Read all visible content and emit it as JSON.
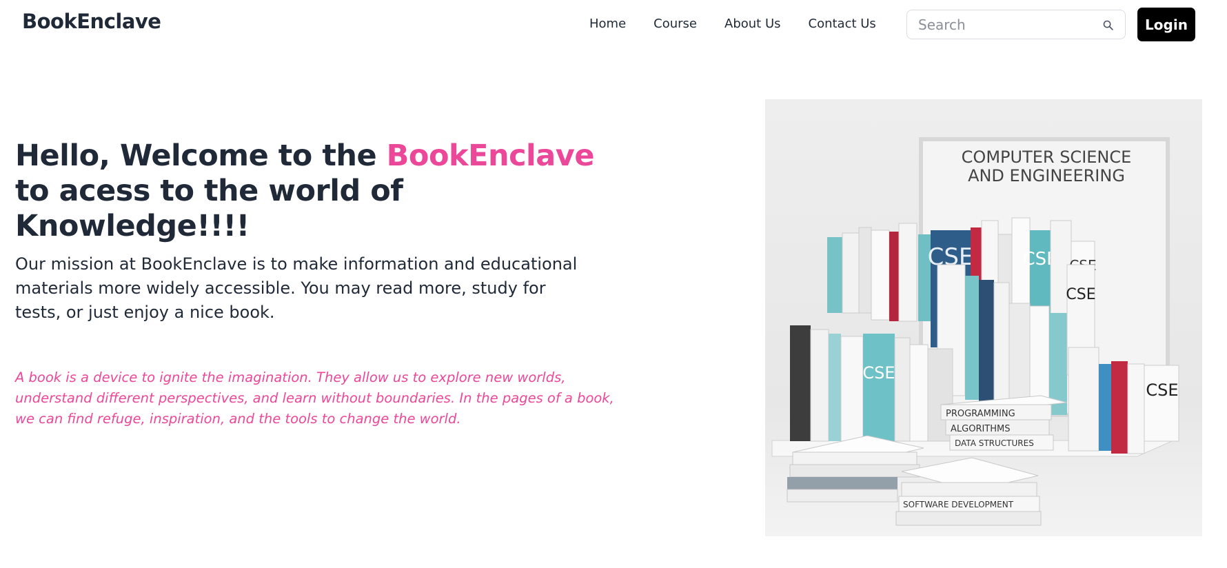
{
  "nav": {
    "brand": "BookEnclave",
    "links": [
      "Home",
      "Course",
      "About Us",
      "Contact Us"
    ],
    "search_placeholder": "Search",
    "login_label": "Login"
  },
  "hero": {
    "title_part1": "Hello, Welcome to the ",
    "title_highlight": "BookEnclave",
    "title_part2": " to acess to the world of Knowledge!!!!",
    "mission": "Our mission at BookEnclave is to make information and educational materials more widely accessible. You may read more, study for tests, or just enjoy a nice book.",
    "quote": "A book is a device to ignite the imagination. They allow us to explore new worlds, understand different perspectives, and learn without boundaries. In the pages of a book, we can find refuge, inspiration, and the tools to change the world."
  },
  "image": {
    "sign_line1": "COMPUTER SCIENCE",
    "sign_line2": "AND ENGINEERING",
    "spine_label": "CSE",
    "stack_labels": [
      "PROGRAMMING",
      "ALGORITHMS",
      "DATA STRUCTURES",
      "SOFTWARE DEVELOPMENT"
    ]
  },
  "colors": {
    "accent": "#ec4899",
    "text": "#1f2937",
    "button": "#000000"
  }
}
